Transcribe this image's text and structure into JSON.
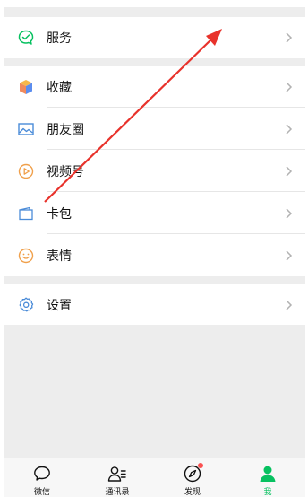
{
  "menu": {
    "service": {
      "label": "服务"
    },
    "favorites": {
      "label": "收藏"
    },
    "moments": {
      "label": "朋友圈"
    },
    "channels": {
      "label": "视频号"
    },
    "cards": {
      "label": "卡包"
    },
    "stickers": {
      "label": "表情"
    },
    "settings": {
      "label": "设置"
    }
  },
  "tabbar": {
    "tabs": [
      {
        "label": "微信",
        "icon": "chat-bubble-icon"
      },
      {
        "label": "通讯录",
        "icon": "contacts-icon"
      },
      {
        "label": "发现",
        "icon": "compass-icon",
        "badge": true
      },
      {
        "label": "我",
        "icon": "person-icon",
        "active": true
      }
    ]
  },
  "colors": {
    "accent": "#07c160",
    "annotation_arrow": "#e8322b",
    "badge": "#fa5151",
    "background_gray": "#ededed"
  }
}
